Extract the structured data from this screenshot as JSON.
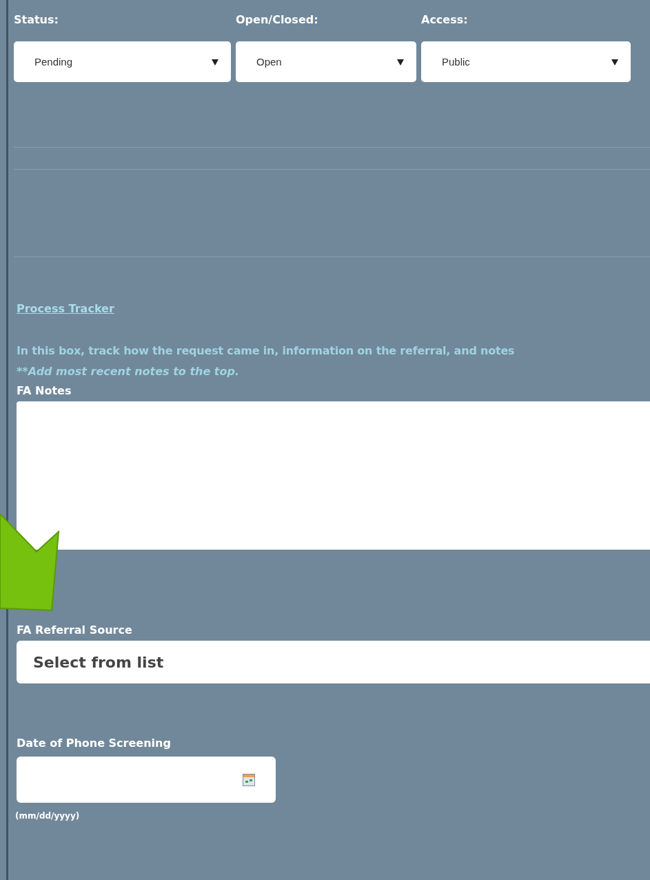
{
  "selects": [
    {
      "label": "Status:",
      "value": "Pending"
    },
    {
      "label": "Open/Closed:",
      "value": "Open"
    },
    {
      "label": "Access:",
      "value": "Public"
    }
  ],
  "process_tracker": {
    "link": "Process Tracker",
    "instructions": "In this box, track how the request came in, information on the referral, and notes",
    "note": "**Add most recent notes to the top."
  },
  "notes": {
    "label": "FA Notes"
  },
  "referral_source": {
    "label": "FA Referral Source",
    "value": "Select from list"
  },
  "phone_screening": {
    "label": "Date of Phone Screening",
    "hint": "(mm/dd/yyyy)"
  }
}
